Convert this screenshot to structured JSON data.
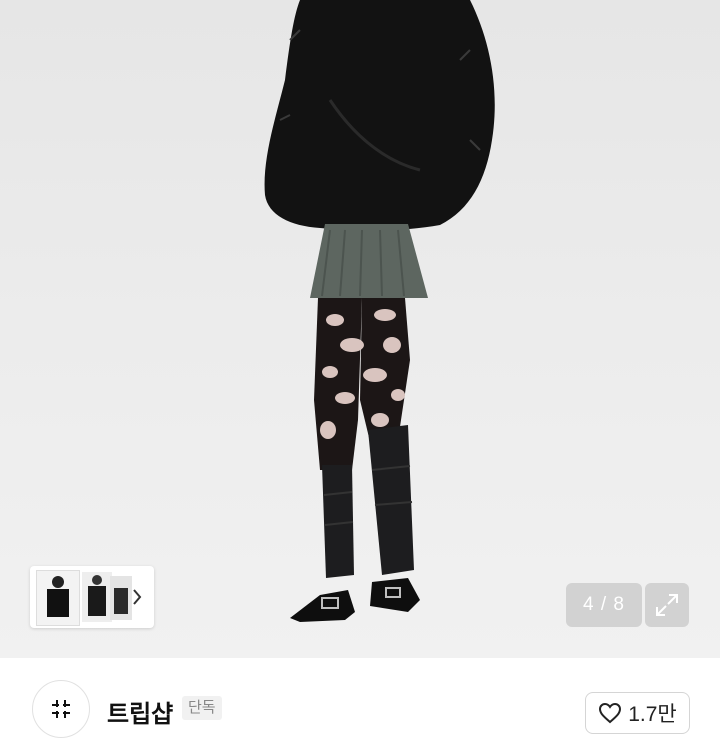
{
  "gallery": {
    "current_index": "4",
    "total": "8",
    "separator": " / ",
    "counter_text": "4 / 8"
  },
  "thumbnails": {
    "next_icon": "chevron-right-icon"
  },
  "expand": {
    "icon": "expand-icon"
  },
  "shop": {
    "name": "트립샵",
    "badge": "단독",
    "logo_icon": "sparkle-cross-icon"
  },
  "like": {
    "icon": "heart-outline-icon",
    "count": "1.7만"
  }
}
